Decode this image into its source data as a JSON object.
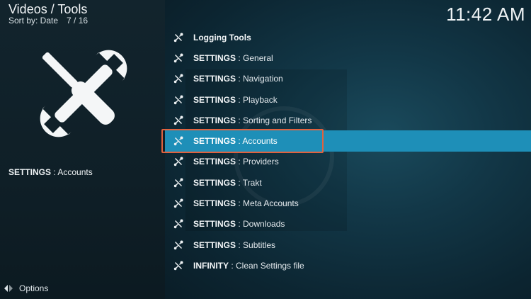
{
  "header": {
    "title": "Videos / Tools",
    "sort_label": "Sort by: Date",
    "position": "7 / 16"
  },
  "clock": "11:42 AM",
  "selected_info": {
    "bold": "SETTINGS",
    "rest": " : Accounts"
  },
  "footer": {
    "options_label": "Options",
    "options_icon": "options-arrows-icon"
  },
  "colors": {
    "selected_row": "#1e8fb8",
    "highlight_border": "#e0623f"
  },
  "menu": [
    {
      "bold": "Logging Tools",
      "rest": "",
      "icon": "tools-icon"
    },
    {
      "bold": "SETTINGS",
      "rest": " : General",
      "icon": "tools-icon"
    },
    {
      "bold": "SETTINGS",
      "rest": " : Navigation",
      "icon": "tools-icon"
    },
    {
      "bold": "SETTINGS",
      "rest": " : Playback",
      "icon": "tools-icon"
    },
    {
      "bold": "SETTINGS",
      "rest": " : Sorting and Filters",
      "icon": "tools-icon"
    },
    {
      "bold": "SETTINGS",
      "rest": " : Accounts",
      "icon": "tools-icon",
      "selected": true
    },
    {
      "bold": "SETTINGS",
      "rest": " : Providers",
      "icon": "tools-icon"
    },
    {
      "bold": "SETTINGS",
      "rest": " : Trakt",
      "icon": "tools-icon"
    },
    {
      "bold": "SETTINGS",
      "rest": " : Meta Accounts",
      "icon": "tools-icon"
    },
    {
      "bold": "SETTINGS",
      "rest": " : Downloads",
      "icon": "tools-icon"
    },
    {
      "bold": "SETTINGS",
      "rest": " : Subtitles",
      "icon": "tools-icon"
    },
    {
      "bold": "INFINITY",
      "rest": " : Clean Settings file",
      "icon": "tools-icon"
    }
  ]
}
